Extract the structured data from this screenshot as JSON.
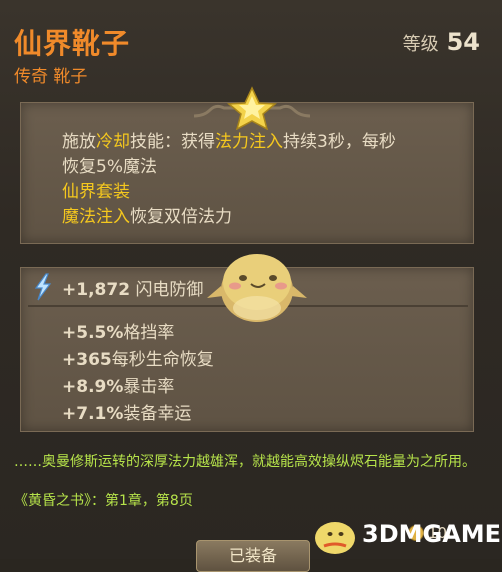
{
  "item": {
    "name": "仙界靴子",
    "type": "传奇 靴子",
    "level_label": "等级",
    "level_value": "54"
  },
  "ability": {
    "p1": "施放",
    "p2": "冷却",
    "p3": "技能：获得",
    "p4": "法力注入",
    "p5": "持续3秒，每秒恢复5%魔法",
    "set_name": "仙界套装",
    "set_bonus_hl": "魔法注入",
    "set_bonus_rest": "恢复双倍法力"
  },
  "stats": {
    "main": {
      "value": "+1,872",
      "label": "闪电防御"
    },
    "lines": [
      {
        "value": "+5.5%",
        "label": "格挡率"
      },
      {
        "value": "+365",
        "label": "每秒生命恢复"
      },
      {
        "value": "+8.9%",
        "label": "暴击率"
      },
      {
        "value": "+7.1%",
        "label": "装备幸运"
      }
    ]
  },
  "lore": {
    "text": "……奥曼修斯运转的深厚法力越雄浑，就越能高效操纵烬石能量为之所用。",
    "source": "《黄昏之书》：第1章，第8页"
  },
  "footer": {
    "button_label": "已装备",
    "coin_value": "100"
  },
  "watermark": {
    "text": "3DMGAME"
  },
  "colors": {
    "legendary": "#f08a2a",
    "highlight": "#f5c81e",
    "lore": "#b6e34a",
    "panel": "#6b5e4e"
  }
}
